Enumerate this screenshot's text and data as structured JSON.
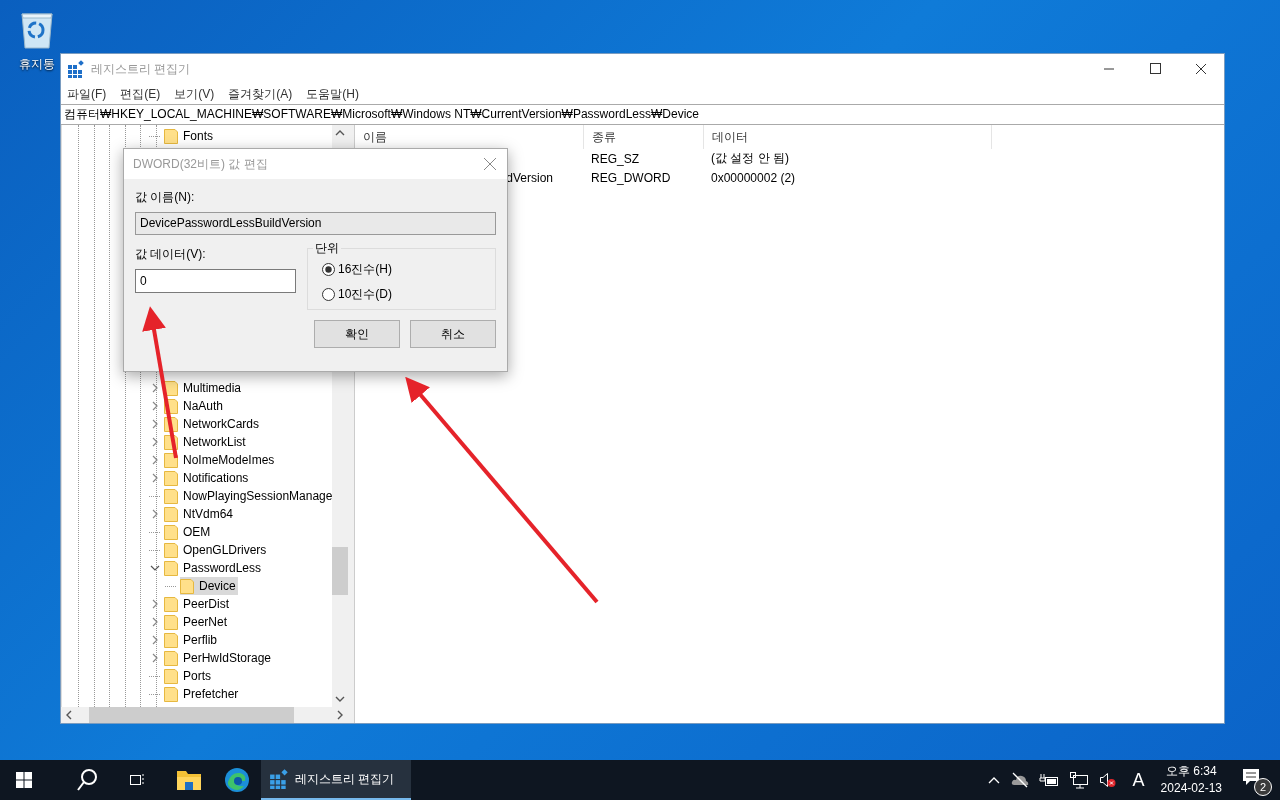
{
  "desktop": {
    "icons": [
      {
        "label": "휴지통"
      }
    ]
  },
  "window": {
    "title": "레지스트리 편집기",
    "menu": [
      "파일(F)",
      "편집(E)",
      "보기(V)",
      "즐겨찾기(A)",
      "도움말(H)"
    ],
    "address": "컴퓨터₩HKEY_LOCAL_MACHINE₩SOFTWARE₩Microsoft₩Windows NT₩CurrentVersion₩PasswordLess₩Device",
    "tree_top": [
      {
        "label": "Fonts",
        "kind": "leaf",
        "selected": false
      }
    ],
    "tree": [
      {
        "label": "Multimedia",
        "kind": "collapsed",
        "selected": false
      },
      {
        "label": "NaAuth",
        "kind": "collapsed",
        "selected": false
      },
      {
        "label": "NetworkCards",
        "kind": "collapsed",
        "selected": false
      },
      {
        "label": "NetworkList",
        "kind": "collapsed",
        "selected": false
      },
      {
        "label": "NoImeModeImes",
        "kind": "collapsed",
        "selected": false
      },
      {
        "label": "Notifications",
        "kind": "collapsed",
        "selected": false
      },
      {
        "label": "NowPlayingSessionManage",
        "kind": "leaf",
        "selected": false
      },
      {
        "label": "NtVdm64",
        "kind": "collapsed",
        "selected": false
      },
      {
        "label": "OEM",
        "kind": "leaf",
        "selected": false
      },
      {
        "label": "OpenGLDrivers",
        "kind": "leaf",
        "selected": false
      },
      {
        "label": "PasswordLess",
        "kind": "expanded",
        "selected": false,
        "children": [
          {
            "label": "Device",
            "kind": "leaf",
            "selected": true
          }
        ]
      },
      {
        "label": "PeerDist",
        "kind": "collapsed",
        "selected": false
      },
      {
        "label": "PeerNet",
        "kind": "collapsed",
        "selected": false
      },
      {
        "label": "Perflib",
        "kind": "collapsed",
        "selected": false
      },
      {
        "label": "PerHwIdStorage",
        "kind": "collapsed",
        "selected": false
      },
      {
        "label": "Ports",
        "kind": "leaf",
        "selected": false
      },
      {
        "label": "Prefetcher",
        "kind": "leaf",
        "selected": false
      }
    ],
    "columns": [
      "이름",
      "종류",
      "데이터"
    ],
    "rows": [
      {
        "type": "REG_SZ",
        "data": "(값 설정 안 됨)"
      },
      {
        "name": "dVersion",
        "type": "REG_DWORD",
        "data": "0x00000002 (2)"
      }
    ]
  },
  "dialog": {
    "title": "DWORD(32비트) 값 편집",
    "name_label": "값 이름(N):",
    "name_value": "DevicePasswordLessBuildVersion",
    "data_label": "값 데이터(V):",
    "data_value": "0",
    "unit_label": "단위",
    "radios": [
      {
        "label": "16진수(H)",
        "selected": true
      },
      {
        "label": "10진수(D)",
        "selected": false
      }
    ],
    "buttons": [
      "확인",
      "취소"
    ]
  },
  "taskbar": {
    "app": {
      "label": "레지스트리 편집기",
      "active": true
    },
    "ime": "A",
    "time": "오후 6:34",
    "date": "2024-02-13",
    "notifications": "2"
  }
}
